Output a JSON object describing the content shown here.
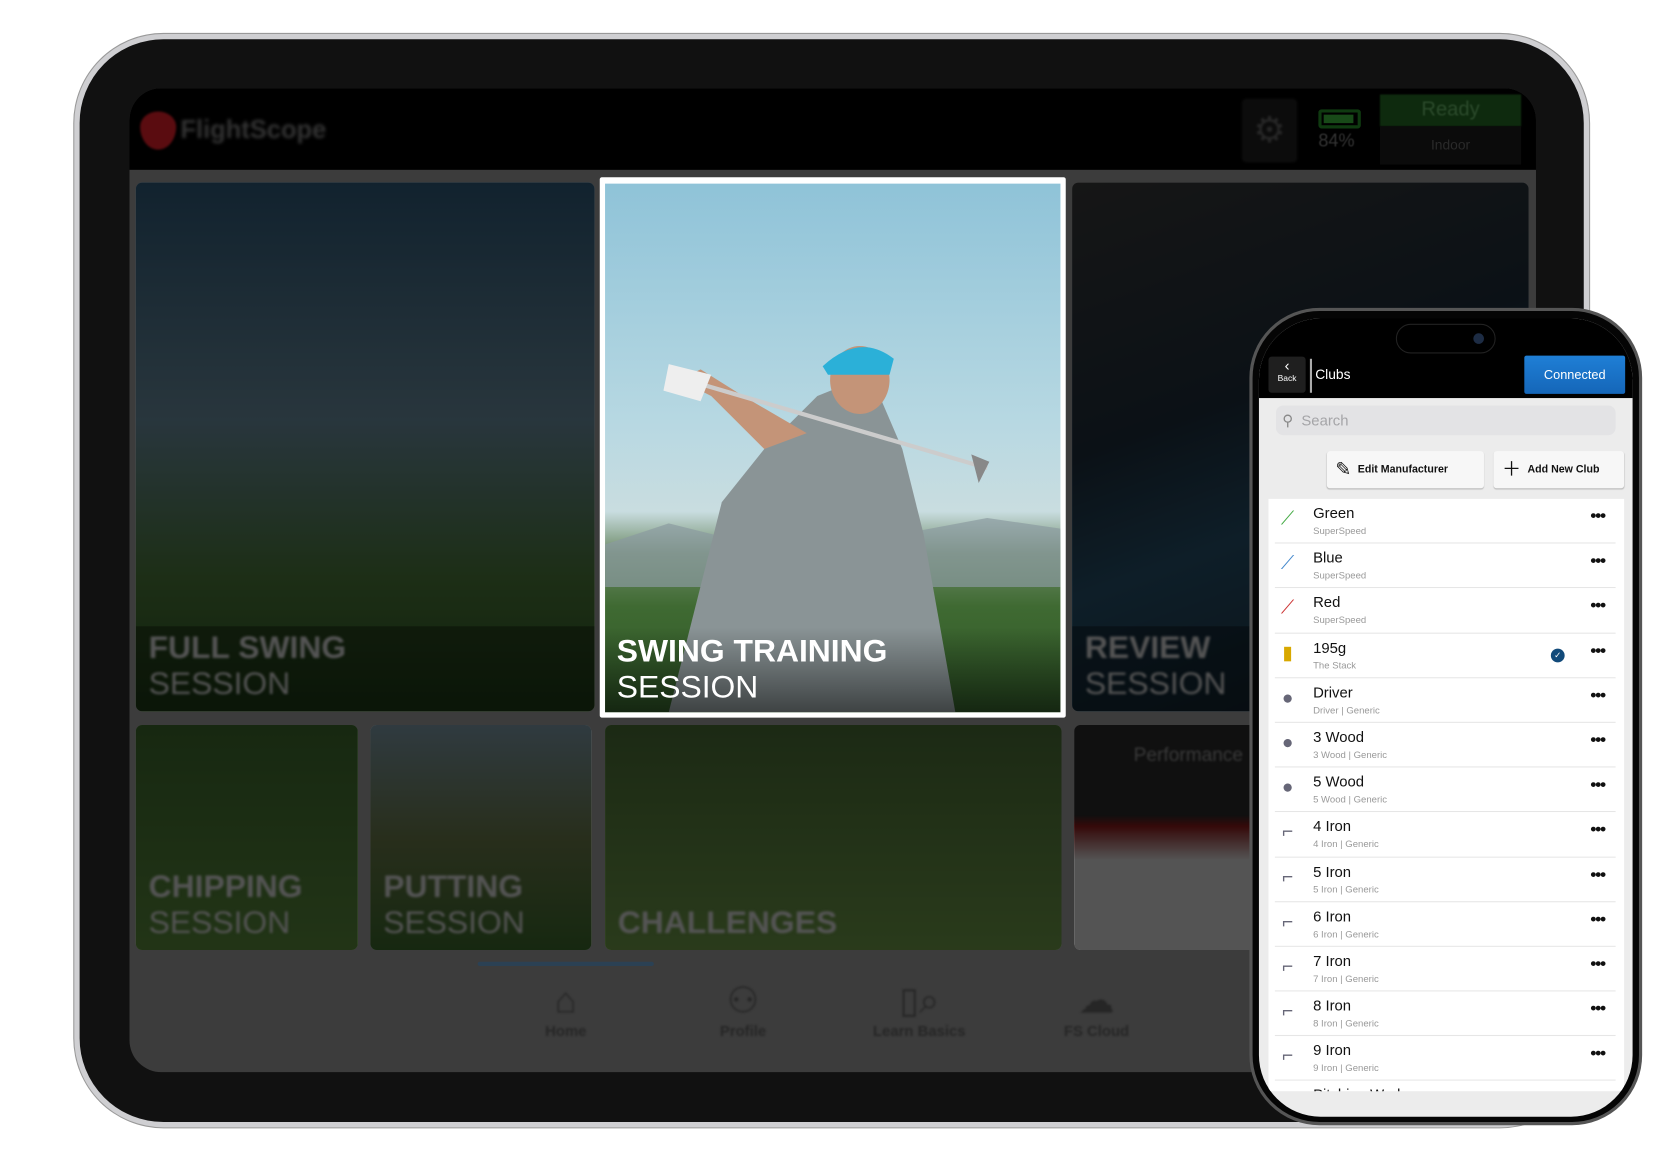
{
  "tablet": {
    "brand": "FlightScope",
    "battery_percent": "84%",
    "status": "Ready",
    "mode": "Indoor",
    "tiles": [
      {
        "line1": "FULL SWING",
        "line2": "SESSION"
      },
      {
        "line1": "SWING TRAINING",
        "line2": "SESSION"
      },
      {
        "line1": "REVIEW",
        "line2": "SESSION"
      },
      {
        "line1": "CHIPPING",
        "line2": "SESSION"
      },
      {
        "line1": "PUTTING",
        "line2": "SESSION"
      },
      {
        "line1": "CHALLENGES",
        "line2": ""
      },
      {
        "line1": "Performance",
        "line2": ""
      }
    ],
    "nav": [
      {
        "label": "Home",
        "icon": "home-icon"
      },
      {
        "label": "Profile",
        "icon": "profile-icon"
      },
      {
        "label": "Learn Basics",
        "icon": "learn-icon"
      },
      {
        "label": "FS Cloud",
        "icon": "cloud-icon"
      }
    ],
    "accent": "#1f7fd6"
  },
  "phone": {
    "back_label": "Back",
    "title": "Clubs",
    "connected_label": "Connected",
    "search_placeholder": "Search",
    "edit_manufacturer": "Edit Manufacturer",
    "add_new_club": "Add New Club",
    "clubs": [
      {
        "name": "Green",
        "sub": "SuperSpeed"
      },
      {
        "name": "Blue",
        "sub": "SuperSpeed"
      },
      {
        "name": "Red",
        "sub": "SuperSpeed"
      },
      {
        "name": "195g",
        "sub": "The Stack",
        "selected": true
      },
      {
        "name": "Driver",
        "sub": "Driver | Generic"
      },
      {
        "name": "3 Wood",
        "sub": "3 Wood | Generic"
      },
      {
        "name": "5 Wood",
        "sub": "5 Wood | Generic"
      },
      {
        "name": "4 Iron",
        "sub": "4 Iron | Generic"
      },
      {
        "name": "5 Iron",
        "sub": "5 Iron | Generic"
      },
      {
        "name": "6 Iron",
        "sub": "6 Iron | Generic"
      },
      {
        "name": "7 Iron",
        "sub": "7 Iron | Generic"
      },
      {
        "name": "8 Iron",
        "sub": "8 Iron | Generic"
      },
      {
        "name": "9 Iron",
        "sub": "9 Iron | Generic"
      },
      {
        "name": "Pitching Wedge",
        "sub": ""
      }
    ]
  }
}
